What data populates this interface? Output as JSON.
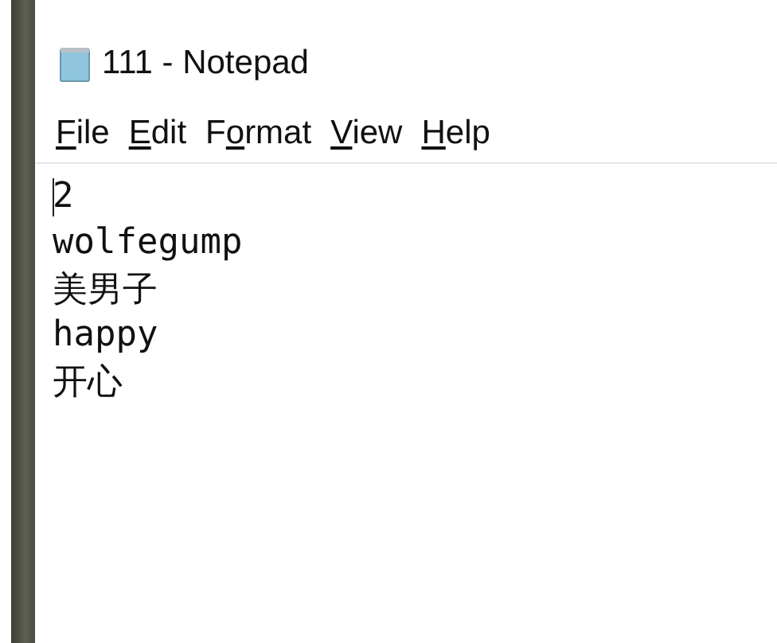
{
  "window": {
    "title": "111 - Notepad"
  },
  "menu": [
    {
      "key": "F",
      "post": "ile"
    },
    {
      "key": "E",
      "post": "dit"
    },
    {
      "pre": "F",
      "key": "o",
      "post": "rmat"
    },
    {
      "key": "V",
      "post": "iew"
    },
    {
      "key": "H",
      "post": "elp"
    }
  ],
  "editor": {
    "lines": [
      {
        "text": "2",
        "caret": true
      },
      {
        "text": "wolfegump",
        "caret": false
      },
      {
        "text": "美男子",
        "caret": false
      },
      {
        "text": "happy",
        "caret": false
      },
      {
        "text": "开心",
        "caret": false
      }
    ]
  }
}
